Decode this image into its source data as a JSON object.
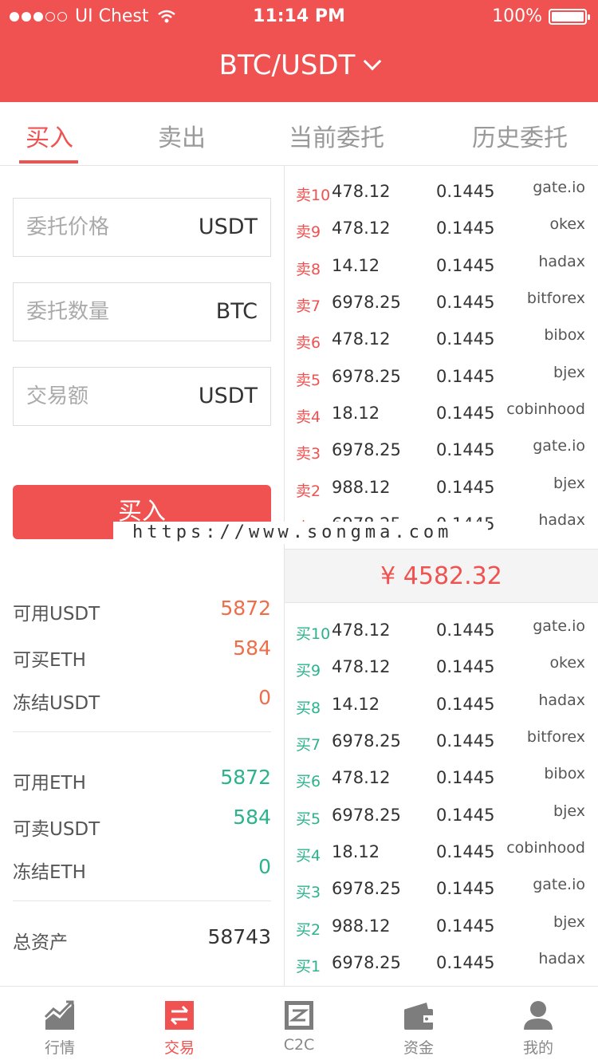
{
  "status_bar": {
    "carrier": "UI Chest",
    "time": "11:14 PM",
    "battery": "100%"
  },
  "header": {
    "pair": "BTC/USDT"
  },
  "tabs": [
    {
      "label": "买入",
      "active": true
    },
    {
      "label": "卖出",
      "active": false
    },
    {
      "label": "当前委托",
      "active": false
    },
    {
      "label": "历史委托",
      "active": false
    }
  ],
  "form": {
    "price": {
      "placeholder": "委托价格",
      "unit": "USDT"
    },
    "quantity": {
      "placeholder": "委托数量",
      "unit": "BTC"
    },
    "total": {
      "placeholder": "交易额",
      "unit": "USDT"
    },
    "submit_label": "买入"
  },
  "account": {
    "usdt_available": {
      "label": "可用USDT",
      "value": "5872"
    },
    "eth_buyable": {
      "label": "可买ETH",
      "value": "584"
    },
    "usdt_frozen": {
      "label": "冻结USDT",
      "value": "0"
    },
    "eth_available": {
      "label": "可用ETH",
      "value": "5872"
    },
    "usdt_sellable": {
      "label": "可卖USDT",
      "value": "584"
    },
    "eth_frozen": {
      "label": "冻结ETH",
      "value": "0"
    },
    "total_assets": {
      "label": "总资产",
      "value": "58743"
    }
  },
  "sell_orders": [
    {
      "level": "卖10",
      "price": "478.12",
      "amount": "0.1445",
      "exchange": "gate.io"
    },
    {
      "level": "卖9",
      "price": "478.12",
      "amount": "0.1445",
      "exchange": "okex"
    },
    {
      "level": "卖8",
      "price": "14.12",
      "amount": "0.1445",
      "exchange": "hadax"
    },
    {
      "level": "卖7",
      "price": "6978.25",
      "amount": "0.1445",
      "exchange": "bitforex"
    },
    {
      "level": "卖6",
      "price": "478.12",
      "amount": "0.1445",
      "exchange": "bibox"
    },
    {
      "level": "卖5",
      "price": "6978.25",
      "amount": "0.1445",
      "exchange": "bjex"
    },
    {
      "level": "卖4",
      "price": "18.12",
      "amount": "0.1445",
      "exchange": "cobinhood"
    },
    {
      "level": "卖3",
      "price": "6978.25",
      "amount": "0.1445",
      "exchange": "gate.io"
    },
    {
      "level": "卖2",
      "price": "988.12",
      "amount": "0.1445",
      "exchange": "bjex"
    },
    {
      "level": "卖1",
      "price": "6978.25",
      "amount": "0.1445",
      "exchange": "hadax"
    }
  ],
  "mid_price": "¥  4582.32",
  "buy_orders": [
    {
      "level": "买10",
      "price": "478.12",
      "amount": "0.1445",
      "exchange": "gate.io"
    },
    {
      "level": "买9",
      "price": "478.12",
      "amount": "0.1445",
      "exchange": "okex"
    },
    {
      "level": "买8",
      "price": "14.12",
      "amount": "0.1445",
      "exchange": "hadax"
    },
    {
      "level": "买7",
      "price": "6978.25",
      "amount": "0.1445",
      "exchange": "bitforex"
    },
    {
      "level": "买6",
      "price": "478.12",
      "amount": "0.1445",
      "exchange": "bibox"
    },
    {
      "level": "买5",
      "price": "6978.25",
      "amount": "0.1445",
      "exchange": "bjex"
    },
    {
      "level": "买4",
      "price": "18.12",
      "amount": "0.1445",
      "exchange": "cobinhood"
    },
    {
      "level": "买3",
      "price": "6978.25",
      "amount": "0.1445",
      "exchange": "gate.io"
    },
    {
      "level": "买2",
      "price": "988.12",
      "amount": "0.1445",
      "exchange": "bjex"
    },
    {
      "level": "买1",
      "price": "6978.25",
      "amount": "0.1445",
      "exchange": "hadax"
    }
  ],
  "watermark": "https://www.songma.com",
  "bottom_nav": [
    {
      "label": "行情",
      "icon": "market-chart-icon",
      "active": false
    },
    {
      "label": "交易",
      "icon": "exchange-arrows-icon",
      "active": true
    },
    {
      "label": "C2C",
      "icon": "c2c-icon",
      "active": false
    },
    {
      "label": "资金",
      "icon": "wallet-icon",
      "active": false
    },
    {
      "label": "我的",
      "icon": "user-icon",
      "active": false
    }
  ],
  "colors": {
    "brand": "#ef5250",
    "sell": "#ef5250",
    "buy": "#2bb38d",
    "balance_red": "#ef6e4a"
  }
}
